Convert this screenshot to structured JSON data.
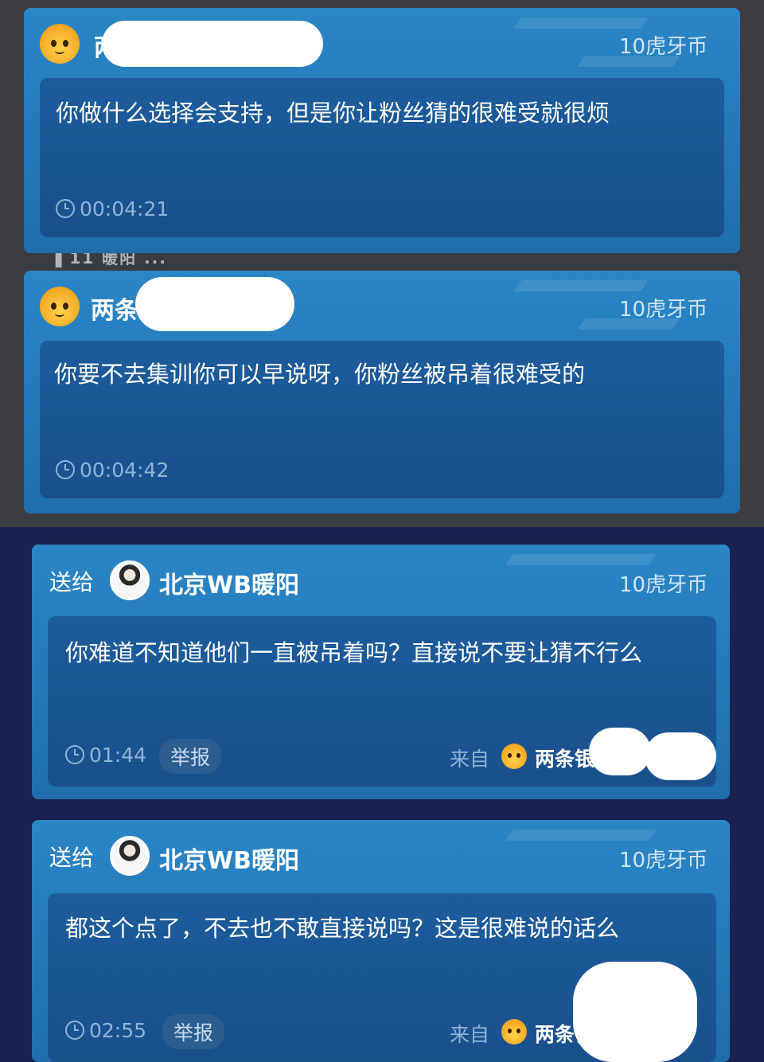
{
  "cards": [
    {
      "sender": "两条银",
      "coins": "10虎牙币",
      "message": "你做什么选择会支持，但是你让粉丝猜的很难受就很烦",
      "time": "00:04:21"
    },
    {
      "sender": "两条银",
      "coins": "10虎牙币",
      "message": "你要不去集训你可以早说呀，你粉丝被吊着很难受的",
      "time": "00:04:42"
    },
    {
      "send_to": "送给",
      "recipient": "北京WB暖阳",
      "coins": "10虎牙币",
      "message": "你难道不知道他们一直被吊着吗？直接说不要让猜不行么",
      "time": "01:44",
      "report": "举报",
      "from_label": "来自",
      "from_name": "两条银"
    },
    {
      "send_to": "送给",
      "recipient": "北京WB暖阳",
      "coins": "10虎牙币",
      "message": "都这个点了，不去也不敢直接说吗？这是很难说的话么",
      "time": "02:55",
      "report": "举报",
      "from_label": "来自",
      "from_name": "两条银"
    }
  ],
  "background_strip_text": "▌11  暖阳  ...",
  "colors": {
    "card_blue": "#2780c0",
    "inner_blue": "#1b5594",
    "dark_band": "#1b2150",
    "time_grey": "#8fb4d8"
  },
  "icons": {
    "clock": "clock-icon",
    "tiger_avatar": "tiger-avatar-icon",
    "user_avatar": "user-avatar"
  }
}
